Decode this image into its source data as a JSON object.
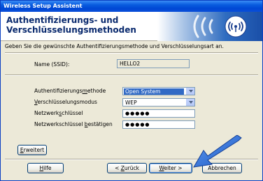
{
  "window": {
    "title": "Wireless Setup Assistent"
  },
  "header": {
    "title": "Authentifizierungs- und Verschlüsselungsmethoden"
  },
  "instruction": "Geben Sie die gewünschte Authentifizierungsmethode und Verschlüsselungsart an.",
  "ssid": {
    "label": "Name (SSID):",
    "value": "HELLO2"
  },
  "auth": {
    "label_pre": "Authentifizierungs",
    "label_mn": "m",
    "label_post": "ethode",
    "value": "Open System"
  },
  "encryption": {
    "label_mn": "V",
    "label_post": "erschlüsselungsmodus",
    "value": "WEP"
  },
  "key": {
    "label_pre": "Netzwerk",
    "label_mn": "s",
    "label_post": "chlüssel",
    "value": "●●●●●"
  },
  "confirm": {
    "label_pre": "Netzwerkschlüssel ",
    "label_mn": "b",
    "label_post": "estätigen",
    "value": "●●●●●"
  },
  "buttons": {
    "advanced_mn": "E",
    "advanced_rest": "rweitert",
    "help_mn": "H",
    "help_rest": "ilfe",
    "back_pre": "< ",
    "back_mn": "Z",
    "back_rest": "urück",
    "next_mn": "W",
    "next_rest": "eiter >",
    "cancel": "Abbrechen"
  },
  "colors": {
    "titlebar": "#0a5ee0",
    "selection": "#316ac5",
    "arrow": "#2a6fd6"
  },
  "icons": {
    "header": "wireless-signal-icon",
    "pointer": "blue-arrow-icon"
  }
}
